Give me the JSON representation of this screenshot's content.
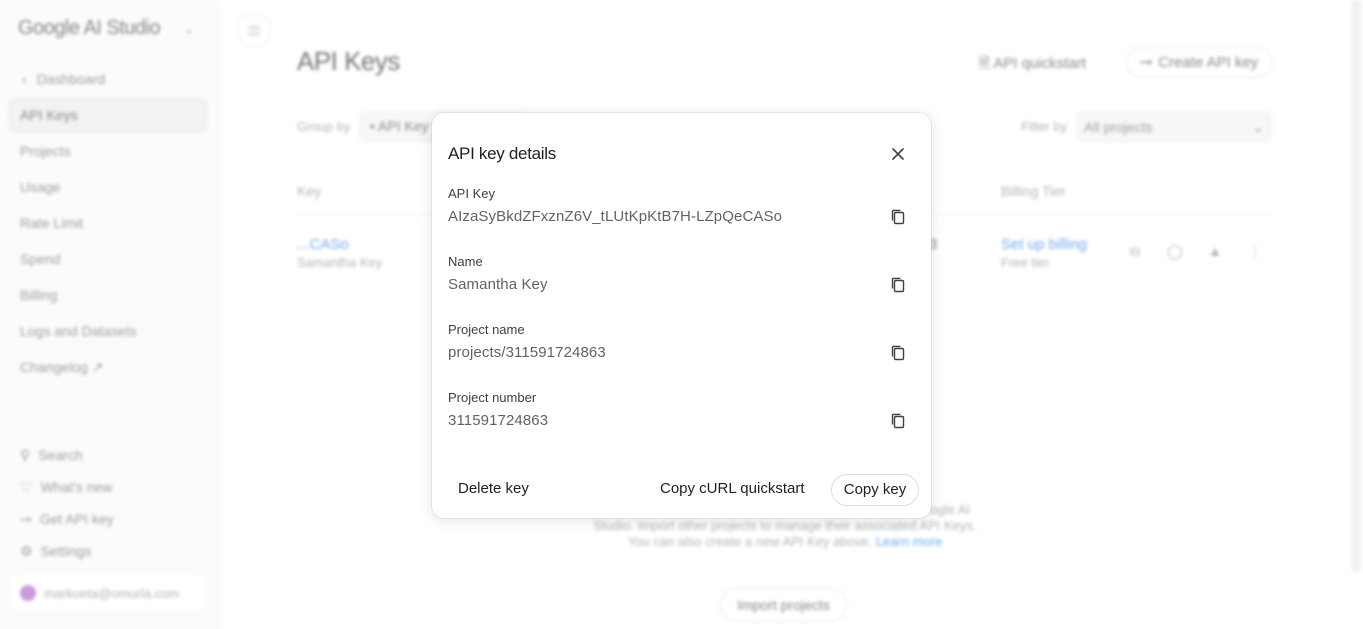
{
  "sidebar": {
    "brand": "Google AI Studio",
    "back_label": "Dashboard",
    "items": [
      {
        "label": "API Keys"
      },
      {
        "label": "Projects"
      },
      {
        "label": "Usage"
      },
      {
        "label": "Rate Limit"
      },
      {
        "label": "Spend"
      },
      {
        "label": "Billing"
      },
      {
        "label": "Logs and Datasets"
      },
      {
        "label": "Changelog"
      }
    ],
    "bottom": [
      {
        "label": "Search"
      },
      {
        "label": "What's new"
      },
      {
        "label": "Get API key"
      },
      {
        "label": "Settings"
      }
    ],
    "account_email": "markoeta@omurla.com"
  },
  "header": {
    "title": "API Keys",
    "quickstart_label": "API quickstart",
    "create_label": "Create API key"
  },
  "toolbar": {
    "group_by_label": "Group by",
    "group_by_value": "API Key",
    "filter_by_label": "Filter by",
    "filter_value": "All projects"
  },
  "table": {
    "col_key": "Key",
    "col_billing": "Billing Tier",
    "row": {
      "key": "...CASo",
      "name": "Samantha Key",
      "fragment": "3",
      "billing_link": "Set up billing",
      "billing_tier": "Free tier"
    }
  },
  "empty_state": {
    "line1": "ogle AI",
    "line2": "Studio. Import other projects to manage their associated API Keys.",
    "line3": "You can also create a new API Key above.",
    "learn_more": "Learn more",
    "import_label": "Import projects"
  },
  "dialog": {
    "title": "API key details",
    "fields": [
      {
        "label": "API Key",
        "value": "AIzaSyBkdZFxznZ6V_tLUtKpKtB7H-LZpQeCASo"
      },
      {
        "label": "Name",
        "value": "Samantha Key"
      },
      {
        "label": "Project name",
        "value": "projects/311591724863"
      },
      {
        "label": "Project number",
        "value": "311591724863"
      }
    ],
    "delete_label": "Delete key",
    "curl_label": "Copy cURL quickstart",
    "copy_label": "Copy key"
  }
}
